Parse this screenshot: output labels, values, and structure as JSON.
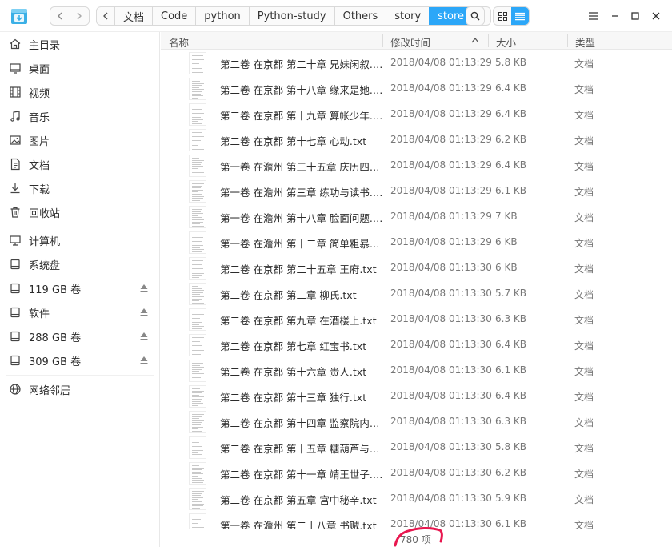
{
  "titlebar": {
    "breadcrumbs": [
      "文档",
      "Code",
      "python",
      "Python-study",
      "Others",
      "story",
      "store"
    ],
    "active_crumb": "store"
  },
  "sidebar": {
    "items": [
      {
        "label": "主目录",
        "icon": "home-icon"
      },
      {
        "label": "桌面",
        "icon": "desktop-icon"
      },
      {
        "label": "视频",
        "icon": "video-icon"
      },
      {
        "label": "音乐",
        "icon": "music-icon"
      },
      {
        "label": "图片",
        "icon": "picture-icon"
      },
      {
        "label": "文档",
        "icon": "document-icon"
      },
      {
        "label": "下载",
        "icon": "download-icon"
      },
      {
        "label": "回收站",
        "icon": "trash-icon"
      }
    ],
    "devices": [
      {
        "label": "计算机",
        "icon": "computer-icon",
        "eject": false
      },
      {
        "label": "系统盘",
        "icon": "drive-icon",
        "eject": false
      },
      {
        "label": "119 GB 卷",
        "icon": "drive-icon",
        "eject": true
      },
      {
        "label": "软件",
        "icon": "drive-icon",
        "eject": true
      },
      {
        "label": "288 GB 卷",
        "icon": "drive-icon",
        "eject": true
      },
      {
        "label": "309 GB 卷",
        "icon": "drive-icon",
        "eject": true
      }
    ],
    "network": {
      "label": "网络邻居",
      "icon": "network-icon"
    }
  },
  "list": {
    "columns": {
      "name": "名称",
      "modified": "修改时间",
      "size": "大小",
      "type": "类型"
    },
    "sort": "ascending",
    "rows": [
      {
        "name": "第二卷 在京都 第二十章 兄妹闲叙.txt",
        "date": "2018/04/08 01:13:29",
        "size": "5.8 KB",
        "type": "文档"
      },
      {
        "name": "第二卷 在京都 第十八章 缘来是她.txt",
        "date": "2018/04/08 01:13:29",
        "size": "6.4 KB",
        "type": "文档"
      },
      {
        "name": "第二卷 在京都 第十九章 算帐少年.txt",
        "date": "2018/04/08 01:13:29",
        "size": "6.4 KB",
        "type": "文档"
      },
      {
        "name": "第二卷 在京都 第十七章 心动.txt",
        "date": "2018/04/08 01:13:29",
        "size": "6.2 KB",
        "type": "文档"
      },
      {
        "name": "第一卷 在澹州 第三十五章 庆历四年…",
        "date": "2018/04/08 01:13:29",
        "size": "6.4 KB",
        "type": "文档"
      },
      {
        "name": "第一卷 在澹州 第三章 练功与读书.txt",
        "date": "2018/04/08 01:13:29",
        "size": "6.1 KB",
        "type": "文档"
      },
      {
        "name": "第一卷 在澹州 第十八章 脸面问题.txt",
        "date": "2018/04/08 01:13:29",
        "size": "7 KB",
        "type": "文档"
      },
      {
        "name": "第一卷 在澹州 第十二章 简单粗暴的…",
        "date": "2018/04/08 01:13:29",
        "size": "6 KB",
        "type": "文档"
      },
      {
        "name": "第二卷 在京都 第二十五章 王府.txt",
        "date": "2018/04/08 01:13:30",
        "size": "6 KB",
        "type": "文档"
      },
      {
        "name": "第二卷 在京都 第二章 柳氏.txt",
        "date": "2018/04/08 01:13:30",
        "size": "5.7 KB",
        "type": "文档"
      },
      {
        "name": "第二卷 在京都 第九章 在酒楼上.txt",
        "date": "2018/04/08 01:13:30",
        "size": "6.3 KB",
        "type": "文档"
      },
      {
        "name": "第二卷 在京都 第七章 红宝书.txt",
        "date": "2018/04/08 01:13:30",
        "size": "6.4 KB",
        "type": "文档"
      },
      {
        "name": "第二卷 在京都 第十六章 贵人.txt",
        "date": "2018/04/08 01:13:30",
        "size": "6.1 KB",
        "type": "文档"
      },
      {
        "name": "第二卷 在京都 第十三章 独行.txt",
        "date": "2018/04/08 01:13:30",
        "size": "6.4 KB",
        "type": "文档"
      },
      {
        "name": "第二卷 在京都 第十四章 监察院内外.…",
        "date": "2018/04/08 01:13:30",
        "size": "6.3 KB",
        "type": "文档"
      },
      {
        "name": "第二卷 在京都 第十五章 糖葫芦与庆…",
        "date": "2018/04/08 01:13:30",
        "size": "5.8 KB",
        "type": "文档"
      },
      {
        "name": "第二卷 在京都 第十一章 靖王世子.txt",
        "date": "2018/04/08 01:13:30",
        "size": "6.2 KB",
        "type": "文档"
      },
      {
        "name": "第二卷 在京都 第五章 宫中秘辛.txt",
        "date": "2018/04/08 01:13:30",
        "size": "5.9 KB",
        "type": "文档"
      },
      {
        "name": "第一卷 在澹州 第二十八章 书贼.txt",
        "date": "2018/04/08 01:13:30",
        "size": "6.1 KB",
        "type": "文档"
      }
    ]
  },
  "status": {
    "count": "780 项"
  },
  "colors": {
    "accent": "#2ca7f8",
    "annotation": "#e8174f"
  }
}
